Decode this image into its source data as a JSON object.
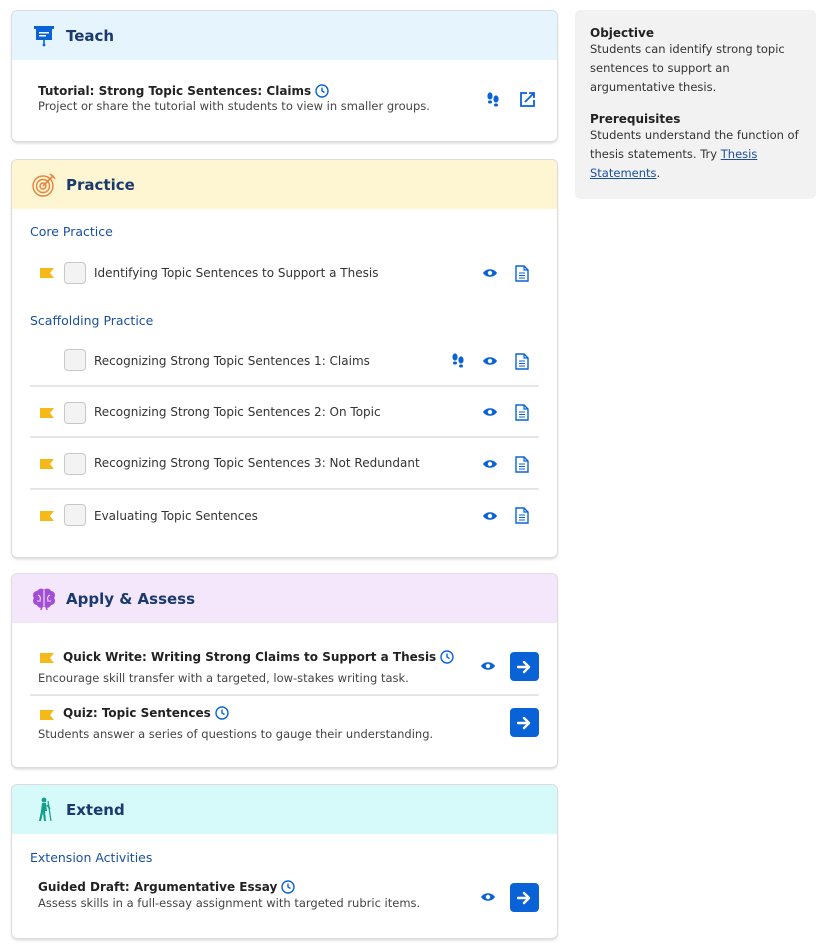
{
  "teach": {
    "title": "Teach",
    "color": "#e6f5fd",
    "tutorial_title": "Tutorial: Strong Topic Sentences: Claims",
    "tutorial_desc": "Project or share the tutorial with students to view in smaller groups."
  },
  "practice": {
    "title": "Practice",
    "color": "#fef6d3",
    "core_heading": "Core Practice",
    "core_items": [
      {
        "label": "Identifying Topic Sentences to Support a Thesis",
        "flagged": true
      }
    ],
    "scaffold_heading": "Scaffolding Practice",
    "scaffold_items": [
      {
        "label": "Recognizing Strong Topic Sentences 1: Claims",
        "flagged": false
      },
      {
        "label": "Recognizing Strong Topic Sentences 2: On Topic",
        "flagged": true
      },
      {
        "label": "Recognizing Strong Topic Sentences 3: Not Redundant",
        "flagged": true
      },
      {
        "label": "Evaluating Topic Sentences",
        "flagged": true
      }
    ]
  },
  "apply": {
    "title": "Apply & Assess",
    "color": "#f4e6fb",
    "items": [
      {
        "title": "Quick Write: Writing Strong Claims to Support a Thesis",
        "desc": "Encourage skill transfer with a targeted, low-stakes writing task."
      },
      {
        "title": "Quiz: Topic Sentences",
        "desc": "Students answer a series of questions to gauge their understanding."
      }
    ]
  },
  "extend": {
    "title": "Extend",
    "color": "#d6fafa",
    "heading": "Extension Activities",
    "item_title": "Guided Draft: Argumentative Essay",
    "item_desc": "Assess skills in a full-essay assignment with targeted rubric items."
  },
  "side": {
    "objective_heading": "Objective",
    "objective_text": "Students can identify strong topic sentences to support an argumentative thesis.",
    "prereq_heading": "Prerequisites",
    "prereq_text_before": "Students understand the function of thesis statements. Try ",
    "prereq_link": "Thesis Statements",
    "prereq_text_after": "."
  },
  "icons": {
    "accent": "#0a63d6",
    "flag": "#f5b919"
  }
}
